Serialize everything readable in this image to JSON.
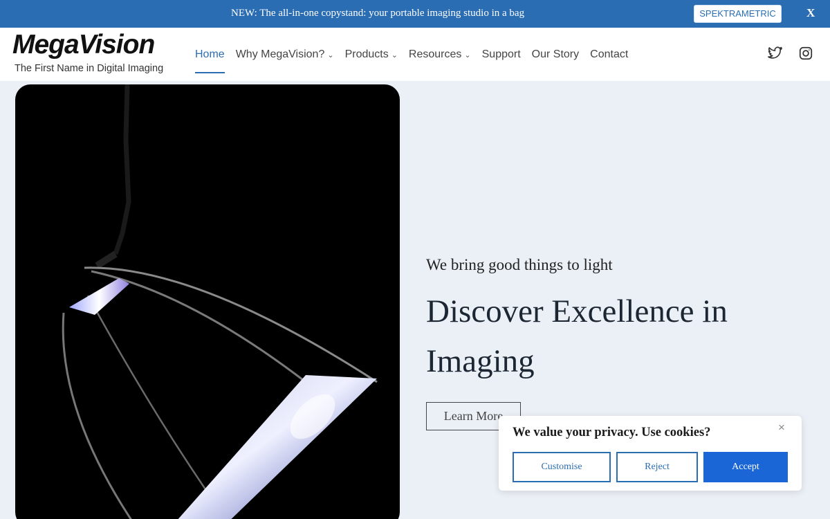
{
  "announcement": {
    "text": "NEW: The all-in-one copystand: your portable imaging studio in a bag",
    "button_label": "SPEKTRAMETRIC",
    "close_label": "X"
  },
  "header": {
    "logo": "MegaVision",
    "tagline": "The First Name in Digital Imaging",
    "nav": [
      {
        "label": "Home",
        "active": true,
        "dropdown": false
      },
      {
        "label": "Why MegaVision?",
        "dropdown": true
      },
      {
        "label": "Products",
        "dropdown": true
      },
      {
        "label": "Resources",
        "dropdown": true
      },
      {
        "label": "Support",
        "dropdown": false
      },
      {
        "label": "Our Story",
        "dropdown": false
      },
      {
        "label": "Contact",
        "dropdown": false
      }
    ],
    "social_icons": [
      "twitter-icon",
      "instagram-icon"
    ]
  },
  "hero": {
    "kicker": "We bring good things to light",
    "headline": "Discover Excellence in Imaging",
    "button_label": "Learn More"
  },
  "cookie": {
    "title": "We value your privacy. Use cookies?",
    "close_label": "×",
    "customise_label": "Customise",
    "reject_label": "Reject",
    "accept_label": "Accept"
  },
  "colors": {
    "accent": "#2a6db3",
    "accept_button": "#1b66d6",
    "page_background": "#ebf0f6"
  }
}
